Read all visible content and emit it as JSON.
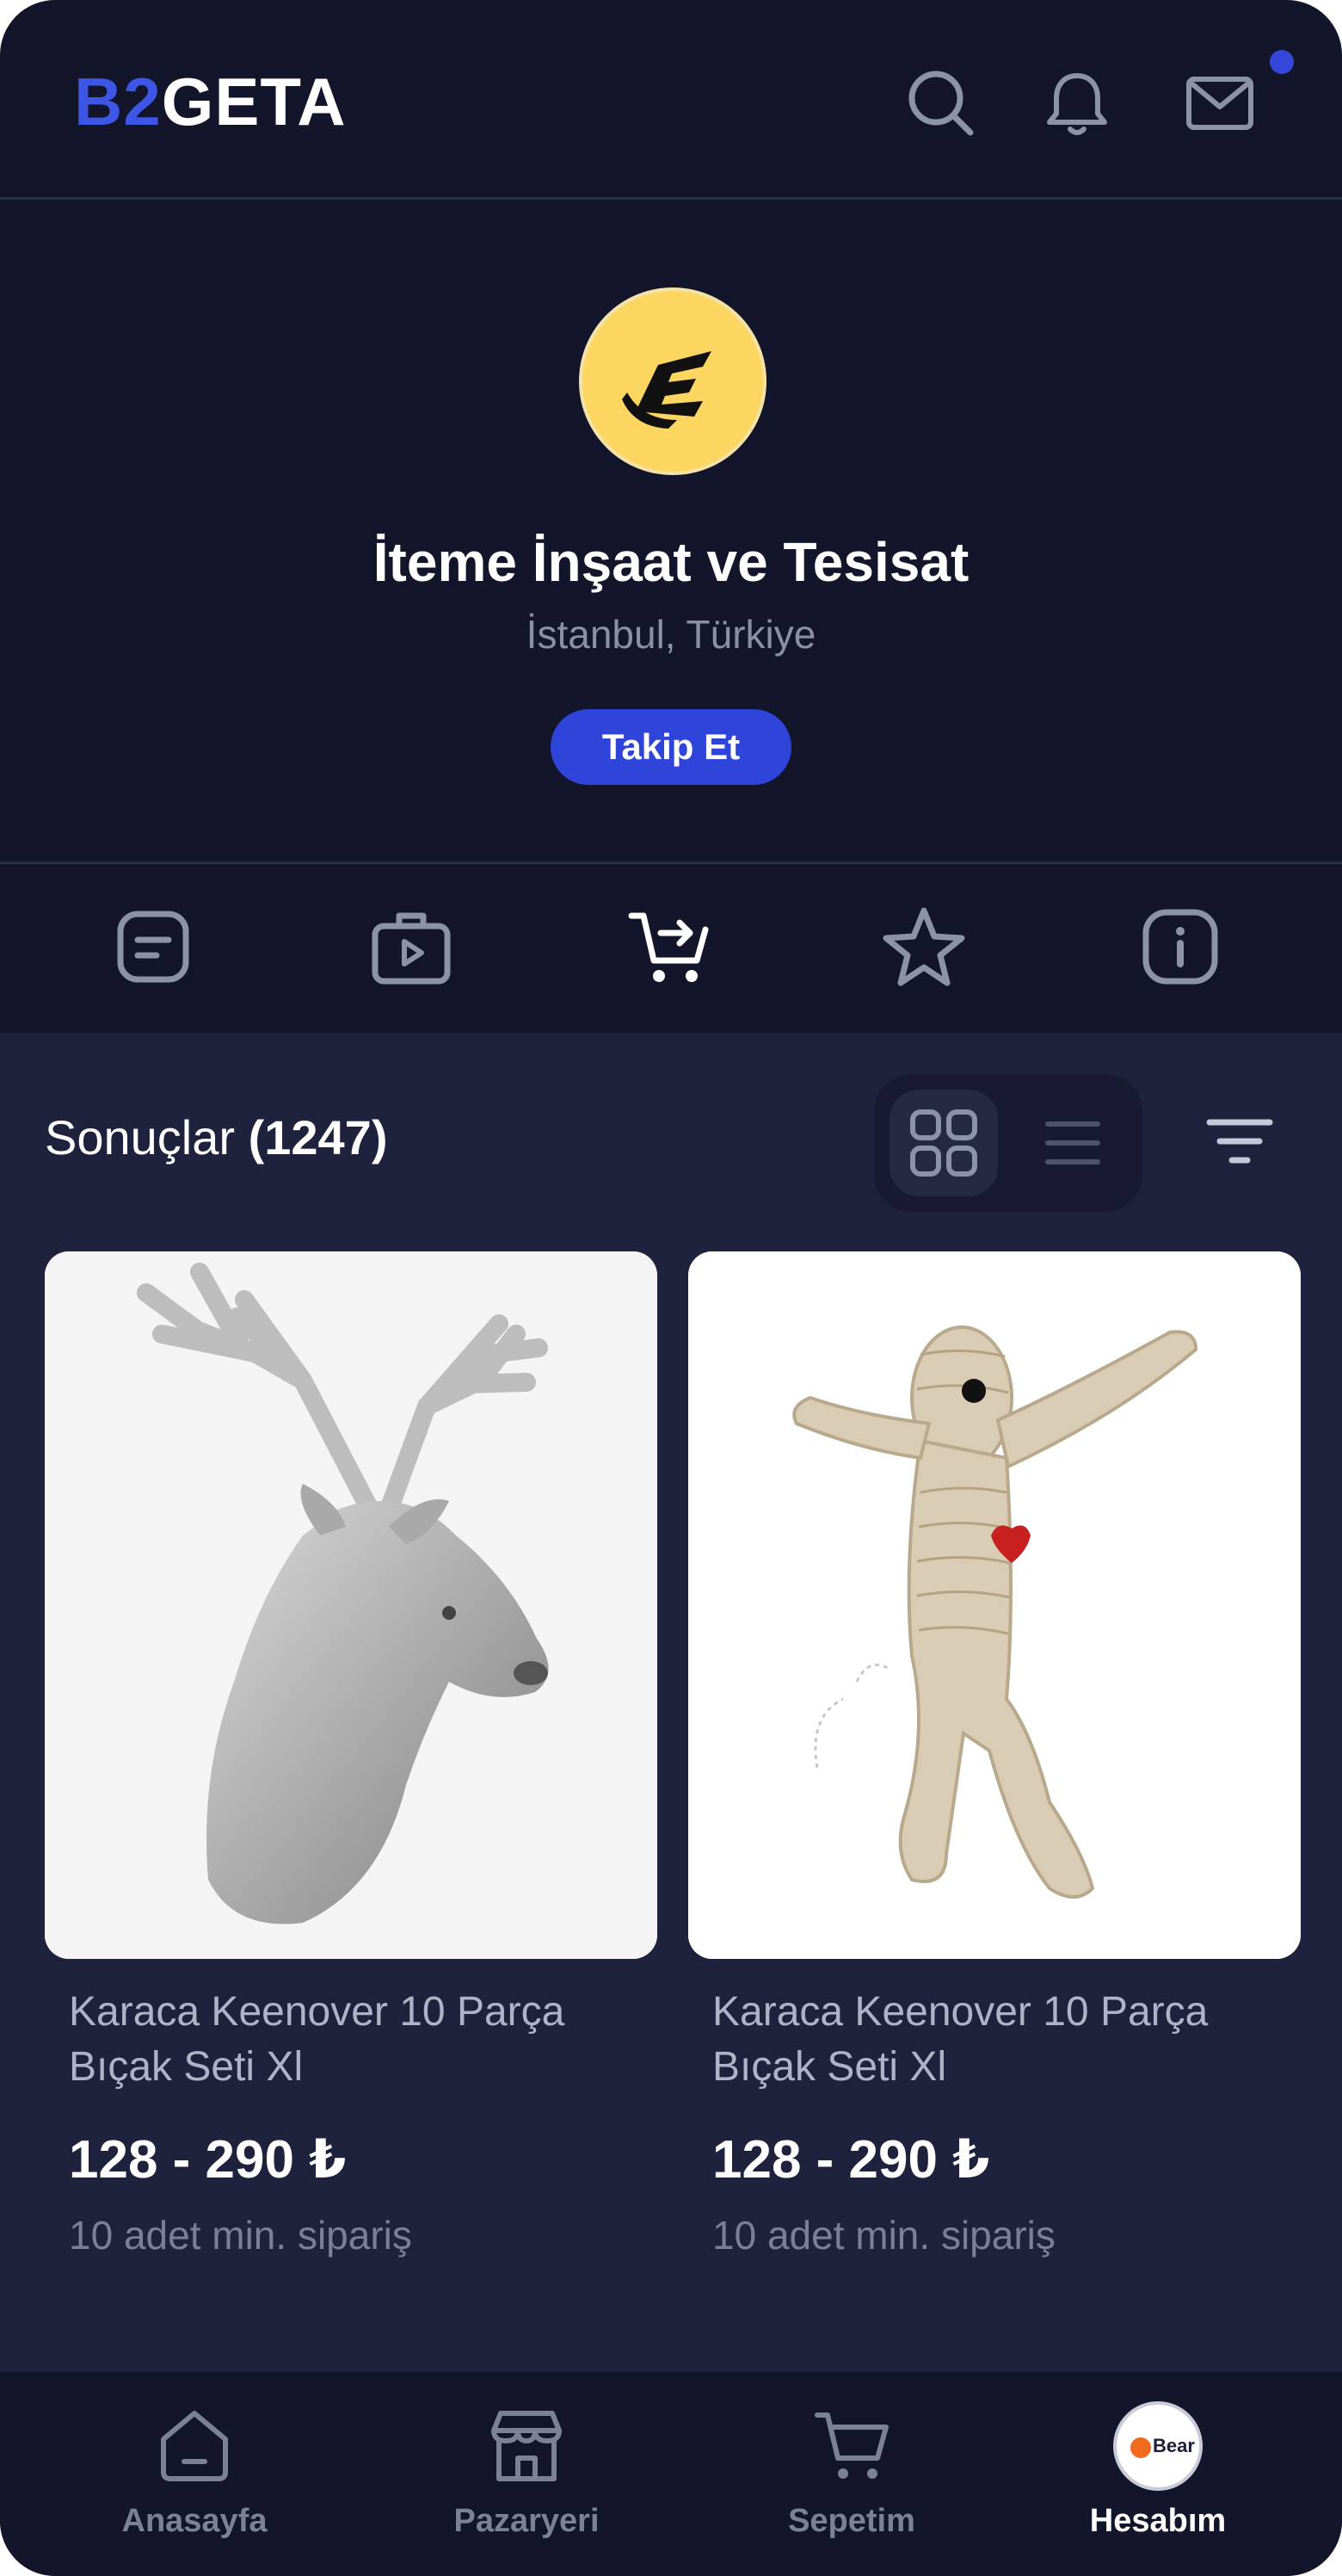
{
  "header": {
    "logo_part1": "B2",
    "logo_part2": "GETA",
    "icons": [
      "search-icon",
      "bell-icon",
      "mail-icon"
    ]
  },
  "store": {
    "name": "İteme İnşaat ve Tesisat",
    "location": "İstanbul, Türkiye",
    "follow_label": "Takip Et"
  },
  "tabs": [
    {
      "icon": "posts-icon"
    },
    {
      "icon": "video-case-icon"
    },
    {
      "icon": "add-to-cart-icon",
      "active": true
    },
    {
      "icon": "star-icon"
    },
    {
      "icon": "info-icon"
    }
  ],
  "results": {
    "label": "Sonuçlar",
    "count": "(1247)",
    "view_mode": "grid"
  },
  "products": [
    {
      "title_line1": "Karaca Keenover 10 Parça",
      "title_line2": "Bıçak Seti Xl",
      "price": "128 - 290 ₺",
      "moq": "10 adet min. sipariş",
      "image": "deer-head-sculpture"
    },
    {
      "title_line1": "Karaca Keenover 10 Parça",
      "title_line2": "Bıçak Seti Xl",
      "price": "128 - 290 ₺",
      "moq": "10 adet min. sipariş",
      "image": "rope-doll-toy"
    }
  ],
  "bottom_nav": [
    {
      "label": "Anasayfa",
      "icon": "home-icon"
    },
    {
      "label": "Pazaryeri",
      "icon": "store-icon"
    },
    {
      "label": "Sepetim",
      "icon": "cart-icon"
    },
    {
      "label": "Hesabım",
      "icon": "account-avatar",
      "active": true,
      "avatar_text": "Bear"
    }
  ],
  "colors": {
    "background": "#13162a",
    "content_bg": "#1f223d",
    "accent": "#2f44d8",
    "logo_blue": "#3d56e6",
    "store_avatar": "#fdd662"
  }
}
